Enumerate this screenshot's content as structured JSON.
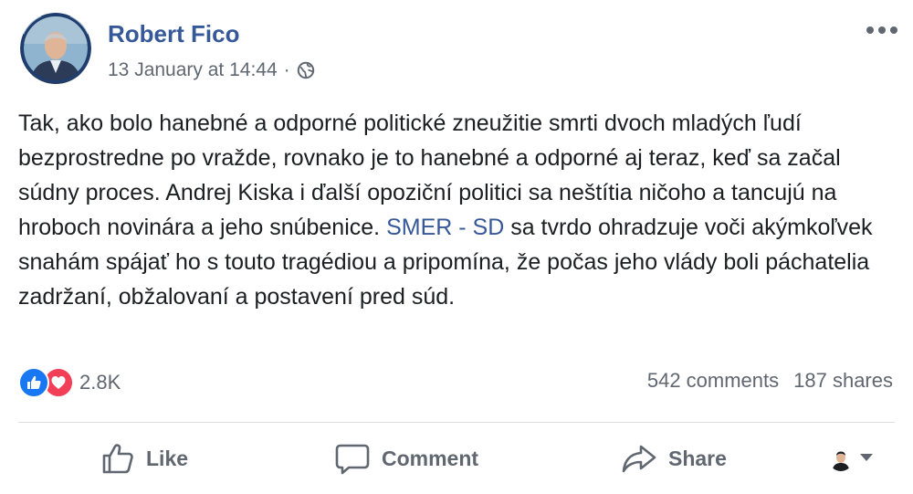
{
  "post": {
    "author": "Robert Fico",
    "timestamp": "13 January at 14:44",
    "separator": "·",
    "privacy_icon": "globe-icon",
    "menu_icon": "more-options-icon",
    "text_before_link": "Tak, ako bolo hanebné a odporné politické zneužitie smrti dvoch mladých ľudí bezprostredne po vražde, rovnako je to hanebné a odporné aj teraz, keď sa začal súdny proces. Andrej Kiska i ďalší opoziční politici sa neštítia ničoho a tancujú na hroboch novinára a jeho snúbenice. ",
    "link_text": "SMER - SD",
    "text_after_link": " sa tvrdo ohradzuje voči akýmkoľvek snahám spájať ho s touto tragédiou a pripomína, že počas jeho vlády boli páchatelia zadržaní, obžalovaní a postavení pred súd."
  },
  "stats": {
    "reactions": [
      "like",
      "love"
    ],
    "reaction_count": "2.8K",
    "comments": "542 comments",
    "shares": "187 shares"
  },
  "actions": {
    "like": "Like",
    "comment": "Comment",
    "share": "Share"
  },
  "colors": {
    "author": "#365899",
    "link": "#365899",
    "secondary_text": "#606770",
    "like_blue": "#1877f2",
    "love_red": "#f33e58",
    "divider": "#dadde1"
  }
}
